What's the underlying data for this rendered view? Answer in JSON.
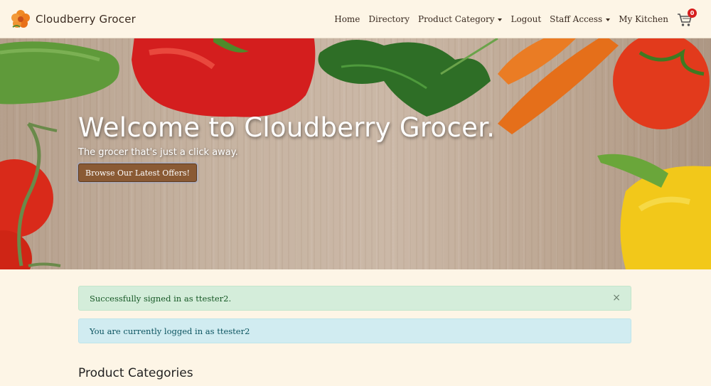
{
  "brand": {
    "name": "Cloudberry Grocer",
    "logo_icon": "cloudberry-flower-icon"
  },
  "nav": {
    "home": "Home",
    "directory": "Directory",
    "product_category": "Product Category",
    "logout": "Logout",
    "staff_access": "Staff Access",
    "my_kitchen": "My Kitchen",
    "cart_icon": "shopping-cart-icon",
    "cart_count": "0"
  },
  "hero": {
    "title": "Welcome to Cloudberry Grocer.",
    "subtitle": "The grocer that's just a click away.",
    "button_label": "Browse Our Latest Offers!"
  },
  "alerts": {
    "success": "Successfully signed in as ttester2.",
    "success_close": "×",
    "info": "You are currently logged in as ttester2"
  },
  "sections": {
    "product_categories": "Product Categories"
  },
  "colors": {
    "page_bg": "#fdf5e6",
    "accent_button": "#8a5a34",
    "alert_success_bg": "#d4edda",
    "alert_info_bg": "#d1ecf1",
    "badge": "#d61e1e"
  }
}
